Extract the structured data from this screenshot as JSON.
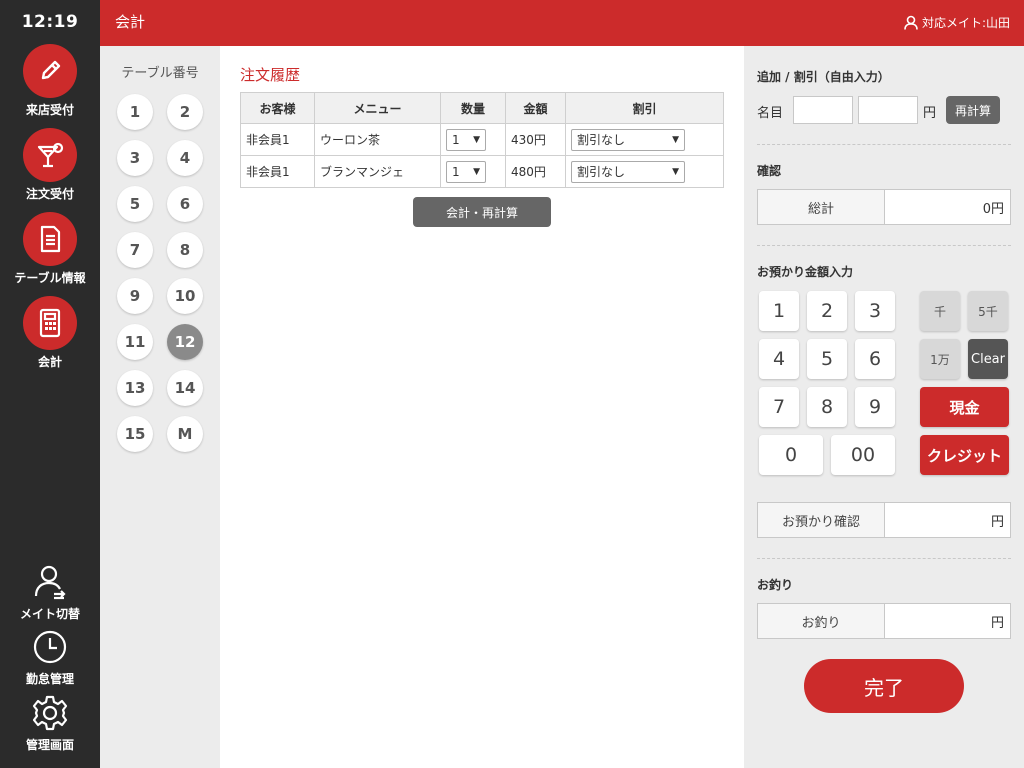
{
  "sidebar": {
    "time": "12:19",
    "items": [
      {
        "label": "来店受付",
        "icon": "pencil-icon"
      },
      {
        "label": "注文受付",
        "icon": "cocktail-icon"
      },
      {
        "label": "テーブル情報",
        "icon": "document-icon"
      },
      {
        "label": "会計",
        "icon": "calculator-icon"
      }
    ],
    "bottom": [
      {
        "label": "メイト切替",
        "icon": "user-switch-icon"
      },
      {
        "label": "勤怠管理",
        "icon": "clock-icon"
      },
      {
        "label": "管理画面",
        "icon": "gear-icon"
      }
    ]
  },
  "header": {
    "title": "会計",
    "staff": "対応メイト:山田"
  },
  "tables": {
    "title": "テーブル番号",
    "numbers": [
      "1",
      "2",
      "3",
      "4",
      "5",
      "6",
      "7",
      "8",
      "9",
      "10",
      "11",
      "12",
      "13",
      "14",
      "15",
      "M"
    ],
    "active": "12"
  },
  "orders": {
    "title": "注文履歴",
    "columns": [
      "お客様",
      "メニュー",
      "数量",
      "金額",
      "割引"
    ],
    "rows": [
      {
        "customer": "非会員1",
        "menu": "ウーロン茶",
        "qty": "1",
        "price": "430円",
        "discount": "割引なし"
      },
      {
        "customer": "非会員1",
        "menu": "ブランマンジェ",
        "qty": "1",
        "price": "480円",
        "discount": "割引なし"
      }
    ],
    "recalc_button": "会計・再計算"
  },
  "right": {
    "add_discount": {
      "title": "追加 / 割引（自由入力）",
      "name_label": "名目",
      "yen": "円",
      "recalc": "再計算"
    },
    "confirm": {
      "title": "確認",
      "total_label": "総計",
      "total_value": "0円"
    },
    "deposit": {
      "title": "お預かり金額入力",
      "keys": [
        "1",
        "2",
        "3",
        "4",
        "5",
        "6",
        "7",
        "8",
        "9",
        "0",
        "00"
      ],
      "k_1000": "千",
      "k_5000": "5千",
      "k_10000": "1万",
      "clear": "Clear",
      "cash": "現金",
      "credit": "クレジット",
      "confirm_label": "お預かり確認",
      "confirm_value": "円"
    },
    "change": {
      "title": "お釣り",
      "label": "お釣り",
      "value": "円"
    },
    "done": "完了"
  }
}
